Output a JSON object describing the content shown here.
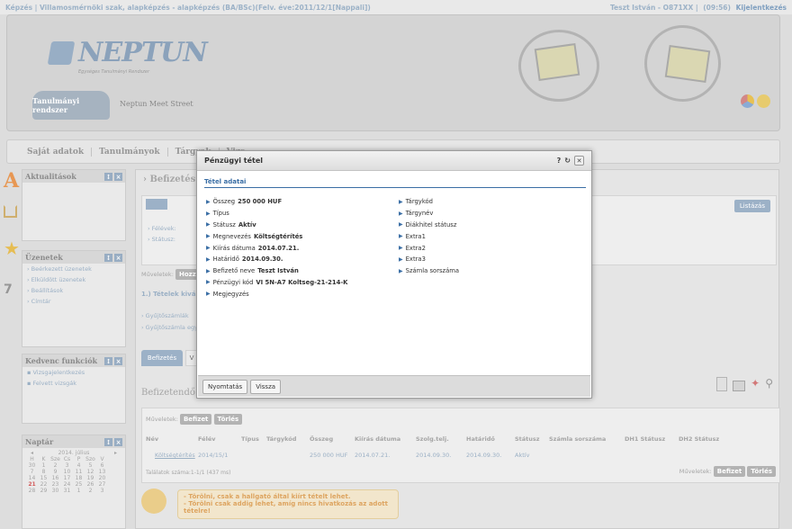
{
  "topbar": {
    "left": "Képzés | Villamosmérnöki szak, alapképzés - alapképzés (BA/BSc)(Felv. éve:2011/12/1[Nappali])",
    "user": "Teszt István - O871XX |",
    "timer": "(09:56)",
    "logout": "Kijelentkezés"
  },
  "header": {
    "logo": "NEPTUN",
    "logo_sub": "Egységes Tanulmányi Rendszer",
    "tab_active": "Tanulmányi rendszer",
    "tab_meet": "Neptun Meet Street"
  },
  "mainnav": [
    "Saját adatok",
    "Tanulmányok",
    "Tárgyak",
    "Vizs"
  ],
  "sidebar": {
    "news": {
      "title": "Aktualitások"
    },
    "messages": {
      "title": "Üzenetek",
      "items": [
        "Beérkezett üzenetek",
        "Elküldött üzenetek",
        "Beállítások",
        "Címtár"
      ]
    },
    "favorites": {
      "title": "Kedvenc funkciók",
      "items": [
        "Vizsgajelentkezés",
        "Felvett vizsgák"
      ]
    },
    "calendar": {
      "title": "Naptár",
      "month": "2014. július",
      "days": [
        "H",
        "K",
        "Sze",
        "Cs",
        "P",
        "Szo",
        "V"
      ],
      "weeks": [
        [
          "30",
          "1",
          "2",
          "3",
          "4",
          "5",
          "6"
        ],
        [
          "7",
          "8",
          "9",
          "10",
          "11",
          "12",
          "13"
        ],
        [
          "14",
          "15",
          "16",
          "17",
          "18",
          "19",
          "20"
        ],
        [
          "21",
          "22",
          "23",
          "24",
          "25",
          "26",
          "27"
        ],
        [
          "28",
          "29",
          "30",
          "31",
          "1",
          "2",
          "3"
        ]
      ]
    }
  },
  "content": {
    "title": "Befizetés",
    "filter_labels": [
      "Félévek:",
      "Státusz:"
    ],
    "list_button": "Listázás",
    "operations_label": "Műveletek:",
    "op_short": "Hozzá",
    "section_1": "1.) Tételek kiválas",
    "links": [
      "Gyűjtőszámlák",
      "Gyűjtőszámla egy"
    ],
    "tab_active": "Befizetés",
    "tab_other": "V",
    "payable_title": "Befizetendő kiír",
    "op_pay": "Befizet",
    "op_delete": "Törlés",
    "table_headers": [
      "Név",
      "Félév",
      "Típus",
      "Tárgykód",
      "Összeg",
      "Kiírás dátuma",
      "Szolg.telj.",
      "Határidő",
      "Státusz",
      "Számla sorszáma",
      "DH1 Státusz",
      "DH2 Státusz"
    ],
    "row": [
      "Költségtérítés",
      "2014/15/1",
      "",
      "",
      "250 000 HUF",
      "2014.07.21.",
      "2014.09.30.",
      "2014.09.30.",
      "Aktív",
      "",
      "",
      ""
    ],
    "results": "Találatok száma:1-1/1 (437 ms)",
    "ops_bottom": "Műveletek:",
    "note_lines": [
      "- Törölni, csak a hallgató által kiírt tételt lehet.",
      "- Törölni csak addig lehet, amíg nincs hivatkozás az adott tételre!"
    ]
  },
  "modal": {
    "title": "Pénzügyi tétel",
    "help": "?",
    "section": "Tétel adatai",
    "left_fields": [
      {
        "label": "Összeg",
        "value": "250 000 HUF"
      },
      {
        "label": "Típus",
        "value": ""
      },
      {
        "label": "Státusz",
        "value": "Aktív"
      },
      {
        "label": "Megnevezés",
        "value": "Költségtérítés"
      },
      {
        "label": "Kiírás dátuma",
        "value": "2014.07.21."
      },
      {
        "label": "Határidő",
        "value": "2014.09.30."
      },
      {
        "label": "Befizető neve",
        "value": "Teszt István"
      },
      {
        "label": "Pénzügyi kód",
        "value": "VI 5N-A7 Koltseg-21-214-K"
      },
      {
        "label": "Megjegyzés",
        "value": ""
      }
    ],
    "right_fields": [
      {
        "label": "Tárgykód",
        "value": ""
      },
      {
        "label": "Tárgynév",
        "value": ""
      },
      {
        "label": "Diákhitel státusz",
        "value": ""
      },
      {
        "label": "Extra1",
        "value": ""
      },
      {
        "label": "Extra2",
        "value": ""
      },
      {
        "label": "Extra3",
        "value": ""
      },
      {
        "label": "Számla sorszáma",
        "value": ""
      }
    ],
    "buttons": {
      "print": "Nyomtatás",
      "back": "Vissza"
    }
  }
}
